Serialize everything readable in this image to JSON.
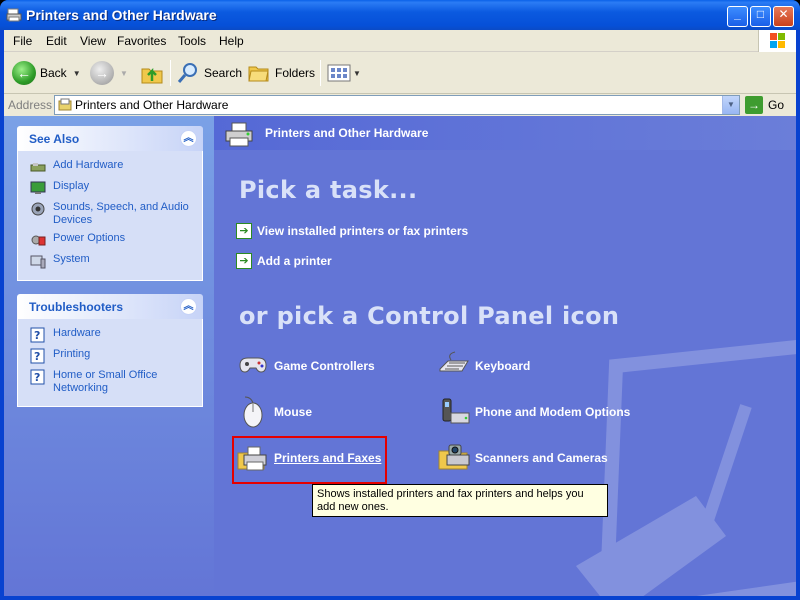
{
  "window": {
    "title": "Printers and Other Hardware",
    "controls": {
      "minimize": "_",
      "maximize": "□",
      "close": "✕"
    }
  },
  "menu": [
    "File",
    "Edit",
    "View",
    "Favorites",
    "Tools",
    "Help"
  ],
  "toolbar": {
    "back_label": "Back",
    "search_label": "Search",
    "folders_label": "Folders"
  },
  "address": {
    "label": "Address",
    "value": "Printers and Other Hardware",
    "go_label": "Go"
  },
  "see_also": {
    "title": "See Also",
    "items": [
      {
        "label": "Add Hardware",
        "icon": "add-hardware-icon"
      },
      {
        "label": "Display",
        "icon": "display-icon"
      },
      {
        "label": "Sounds, Speech, and Audio Devices",
        "icon": "sounds-icon"
      },
      {
        "label": "Power Options",
        "icon": "power-options-icon"
      },
      {
        "label": "System",
        "icon": "system-icon"
      }
    ]
  },
  "troubleshooters": {
    "title": "Troubleshooters",
    "items": [
      {
        "label": "Hardware",
        "icon": "help-icon"
      },
      {
        "label": "Printing",
        "icon": "help-icon"
      },
      {
        "label": "Home or Small Office Networking",
        "icon": "help-icon"
      }
    ]
  },
  "banner": {
    "title": "Printers and Other Hardware"
  },
  "pick_task": {
    "heading": "Pick a task...",
    "tasks": [
      {
        "label": "View installed printers or fax printers"
      },
      {
        "label": "Add a printer"
      }
    ]
  },
  "pick_icon": {
    "heading": "or pick a Control Panel icon",
    "icons": [
      {
        "label": "Game Controllers",
        "icon": "game-controller-icon"
      },
      {
        "label": "Keyboard",
        "icon": "keyboard-icon"
      },
      {
        "label": "Mouse",
        "icon": "mouse-icon"
      },
      {
        "label": "Phone and Modem Options",
        "icon": "phone-modem-icon"
      },
      {
        "label": "Printers and Faxes",
        "icon": "printer-fax-icon"
      },
      {
        "label": "Scanners and Cameras",
        "icon": "scanner-camera-icon"
      }
    ]
  },
  "tooltip": {
    "text": "Shows installed printers and fax printers and helps you add new ones."
  },
  "colors": {
    "title_bar": "#0a5ae0",
    "content_bg": "#6375d6",
    "link_blue": "#215dc6",
    "highlight": "#e60000",
    "tooltip_bg": "#ffffe1"
  }
}
